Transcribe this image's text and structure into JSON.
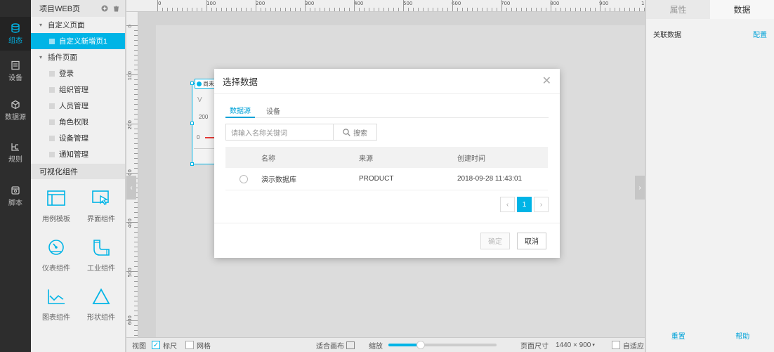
{
  "nav": [
    {
      "label": "组态",
      "icon": "database-icon",
      "active": true
    },
    {
      "label": "设备",
      "icon": "device-icon",
      "active": false
    },
    {
      "label": "数据源",
      "icon": "cube-icon",
      "active": false
    },
    {
      "label": "规则",
      "icon": "rule-icon",
      "active": false
    },
    {
      "label": "脚本",
      "icon": "script-icon",
      "active": false
    }
  ],
  "project": {
    "title": "项目WEB页",
    "custom_group": "自定义页面",
    "custom_pages": [
      "自定义新增页1"
    ],
    "plugin_group": "插件页面",
    "plugin_pages": [
      "登录",
      "组织管理",
      "人员管理",
      "角色权限",
      "设备管理",
      "通知管理"
    ]
  },
  "components": {
    "title": "可视化组件",
    "items": [
      {
        "label": "用例模板",
        "icon": "template-icon"
      },
      {
        "label": "界面组件",
        "icon": "ui-component-icon"
      },
      {
        "label": "仪表组件",
        "icon": "gauge-icon"
      },
      {
        "label": "工业组件",
        "icon": "pipe-icon"
      },
      {
        "label": "图表组件",
        "icon": "chart-icon"
      },
      {
        "label": "形状组件",
        "icon": "triangle-icon"
      }
    ]
  },
  "ruler": {
    "top": [
      "0",
      "100",
      "200",
      "300",
      "400",
      "500",
      "600",
      "700",
      "800",
      "900",
      "1("
    ],
    "left": [
      "0",
      "100",
      "200",
      "300",
      "400",
      "500",
      "600"
    ]
  },
  "widget": {
    "tag": "尚未",
    "v_label": "V",
    "tick_200": "200",
    "tick_0": "0"
  },
  "bottom": {
    "view": "视图",
    "ruler": "标尺",
    "ruler_checked": true,
    "grid": "网格",
    "grid_checked": false,
    "fit_canvas": "适合画布",
    "zoom": "缩放",
    "zoom_level": 0.3,
    "page_size_label": "页面尺寸",
    "page_size_value": "1440 × 900",
    "adaptive": "自适应"
  },
  "right": {
    "tabs": [
      "属性",
      "数据"
    ],
    "active_tab": 1,
    "related_data": "关联数据",
    "config": "配置",
    "reset": "重置",
    "help": "帮助"
  },
  "modal": {
    "title": "选择数据",
    "tabs": [
      "数据源",
      "设备"
    ],
    "active_tab": 0,
    "search_placeholder": "请输入名称关键词",
    "search_button": "搜索",
    "columns": [
      "名称",
      "来源",
      "创建时间"
    ],
    "rows": [
      {
        "name": "演示数据库",
        "source": "PRODUCT",
        "created": "2018-09-28 11:43:01"
      }
    ],
    "page": "1",
    "confirm": "确定",
    "cancel": "取消"
  },
  "colors": {
    "accent": "#00b4e6",
    "nav_bg": "#2d2d2d"
  }
}
